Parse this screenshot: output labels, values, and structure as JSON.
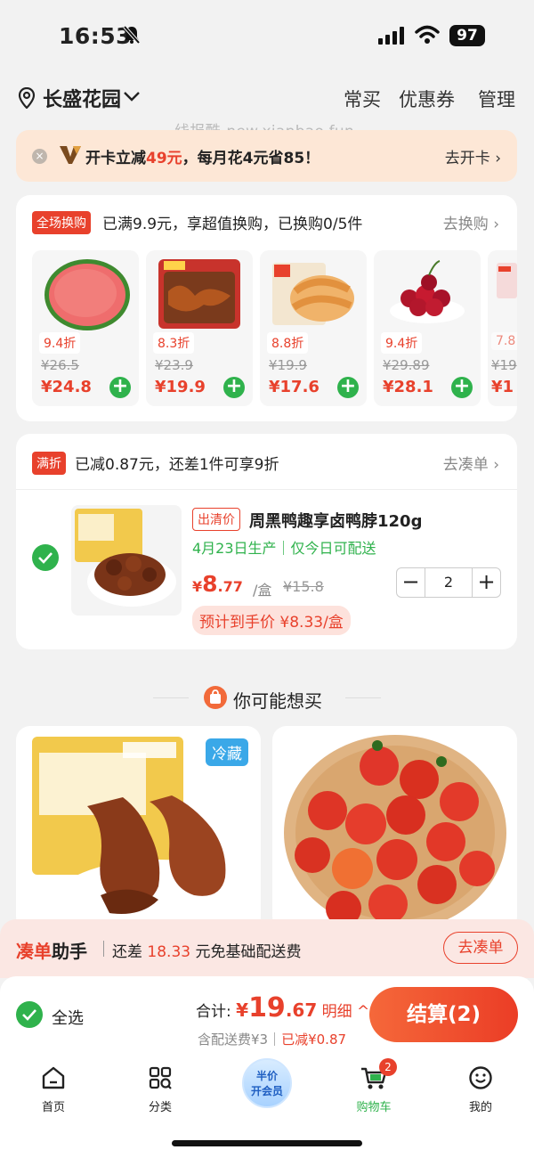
{
  "status_bar": {
    "time": "16:53",
    "battery": "97"
  },
  "header": {
    "address": "长盛花园",
    "links": [
      "常买",
      "优惠券",
      "管理"
    ]
  },
  "watermark": "线报酷-new.xianbao.fun",
  "promo": {
    "text_pre": "开卡立减",
    "amount": "49元",
    "text_post": "，每月花4元省85！",
    "action": "去开卡 ›"
  },
  "swap": {
    "tag": "全场换购",
    "text": "已满9.9元，享超值换购，已换购0/5件",
    "action": "去换购 ›",
    "products": [
      {
        "discount": "9.4折",
        "orig": "¥26.5",
        "price": "¥24.8"
      },
      {
        "discount": "8.3折",
        "orig": "¥23.9",
        "price": "¥19.9"
      },
      {
        "discount": "8.8折",
        "orig": "¥19.9",
        "price": "¥17.6"
      },
      {
        "discount": "9.4折",
        "orig": "¥29.89",
        "price": "¥28.1"
      },
      {
        "discount": "7.8",
        "orig": "¥19",
        "price": "¥1"
      }
    ]
  },
  "discount_section": {
    "tag": "满折",
    "text": "已减0.87元，还差1件可享9折",
    "action": "去凑单 ›",
    "item": {
      "clearance_tag": "出清价",
      "title": "周黑鸭趣享卤鸭脖120g",
      "date_info": "4月23日生产｜仅今日可配送",
      "price_yen": "¥",
      "price_big": "8",
      "price_small": ".77",
      "unit": "/盒",
      "orig": "¥15.8",
      "qty": "2",
      "estimate": "预计到手价 ¥8.33/盒"
    }
  },
  "recommend": {
    "title": "你可能想买",
    "cold_tag": "冷藏"
  },
  "helper": {
    "brand_red": "凑单",
    "brand_black": "助手",
    "text_pre": "还差",
    "amount": "18.33",
    "text_post": "元免基础配送费",
    "action": "去凑单"
  },
  "checkout": {
    "select_all": "全选",
    "total_label": "合计:",
    "yen": "¥",
    "big": "19",
    "small": ".67",
    "detail": "明细 ^",
    "fee_text": "含配送费¥3｜",
    "reduced": "已减¥0.87",
    "pay": "结算(2)"
  },
  "tabbar": {
    "items": [
      {
        "label": "首页"
      },
      {
        "label": "分类"
      },
      {
        "label": "购物车",
        "badge": "2"
      },
      {
        "label": "我的"
      }
    ],
    "member_line1": "半价",
    "member_line2": "开会员"
  },
  "colors": {
    "accent_red": "#e8412c",
    "green": "#2fb24c"
  }
}
